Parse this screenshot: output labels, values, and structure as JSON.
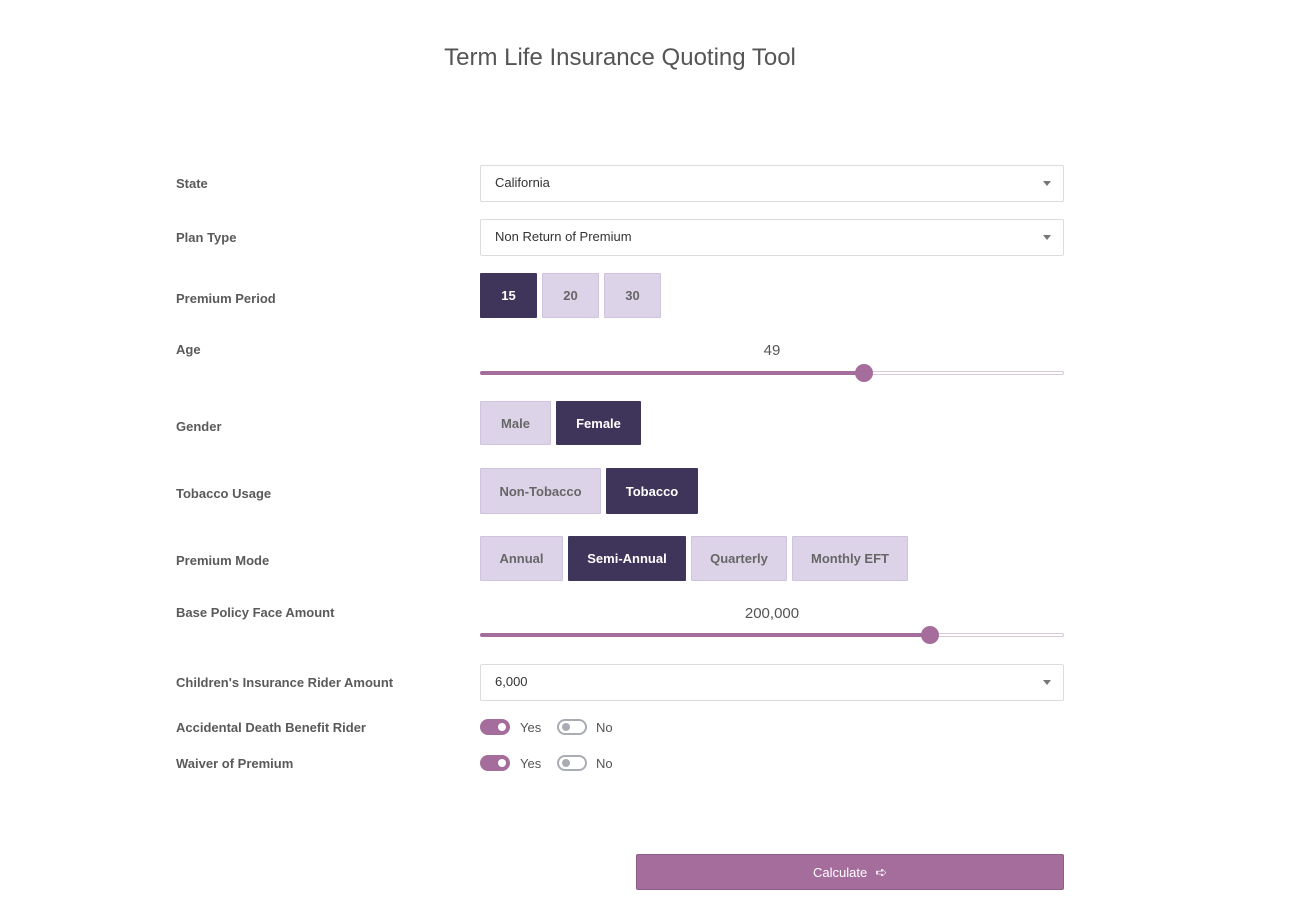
{
  "title": "Term Life Insurance Quoting Tool",
  "labels": {
    "state": "State",
    "plan_type": "Plan Type",
    "premium_period": "Premium Period",
    "age": "Age",
    "gender": "Gender",
    "tobacco": "Tobacco Usage",
    "premium_mode": "Premium Mode",
    "face_amount": "Base Policy Face Amount",
    "children_rider": "Children's Insurance Rider Amount",
    "adb_rider": "Accidental Death Benefit Rider",
    "waiver": "Waiver of Premium"
  },
  "state": {
    "value": "California"
  },
  "plan_type": {
    "value": "Non Return of Premium"
  },
  "premium_period": {
    "options": [
      "15",
      "20",
      "30"
    ],
    "selected": "15"
  },
  "age": {
    "value": "49",
    "fraction": 0.657
  },
  "gender": {
    "options": [
      "Male",
      "Female"
    ],
    "selected": "Female"
  },
  "tobacco": {
    "options": [
      "Non-Tobacco",
      "Tobacco"
    ],
    "selected": "Tobacco"
  },
  "premium_mode": {
    "options": [
      "Annual",
      "Semi-Annual",
      "Quarterly",
      "Monthly EFT"
    ],
    "selected": "Semi-Annual"
  },
  "face_amount": {
    "value": "200,000",
    "fraction": 0.771
  },
  "children_rider": {
    "value": "6,000"
  },
  "adb_rider": {
    "yes": "Yes",
    "no": "No",
    "selected": "Yes"
  },
  "waiver": {
    "yes": "Yes",
    "no": "No",
    "selected": "Yes"
  },
  "calculate": {
    "label": "Calculate",
    "icon": "arrow-right-icon"
  },
  "colors": {
    "accent": "#a56d9c",
    "active": "#3f3459",
    "inactive": "#ddd3e8"
  }
}
